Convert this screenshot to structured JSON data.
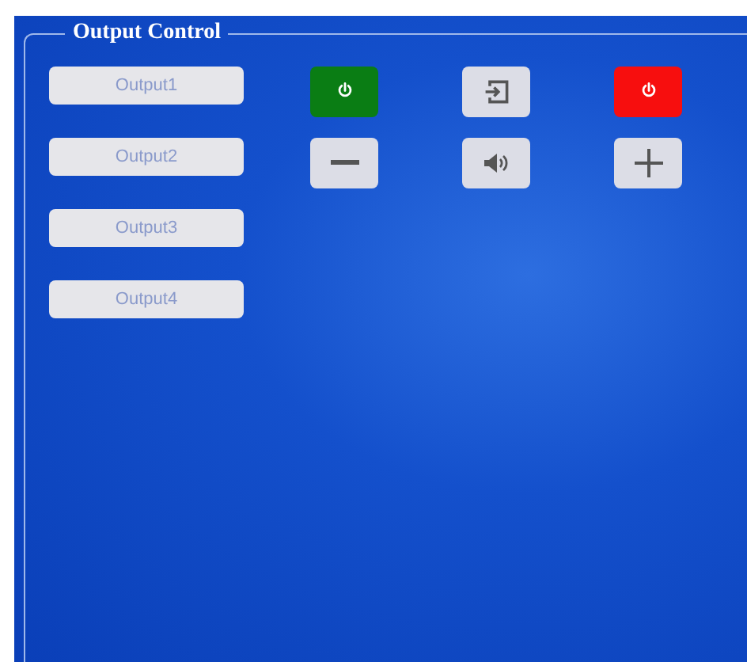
{
  "panel": {
    "title": "Output Control"
  },
  "outputs": [
    {
      "label": "Output1"
    },
    {
      "label": "Output2"
    },
    {
      "label": "Output3"
    },
    {
      "label": "Output4"
    }
  ],
  "controls": [
    {
      "kind": "power-on"
    },
    {
      "kind": "input"
    },
    {
      "kind": "power-off"
    },
    {
      "kind": "minus"
    },
    {
      "kind": "volume"
    },
    {
      "kind": "plus"
    }
  ]
}
